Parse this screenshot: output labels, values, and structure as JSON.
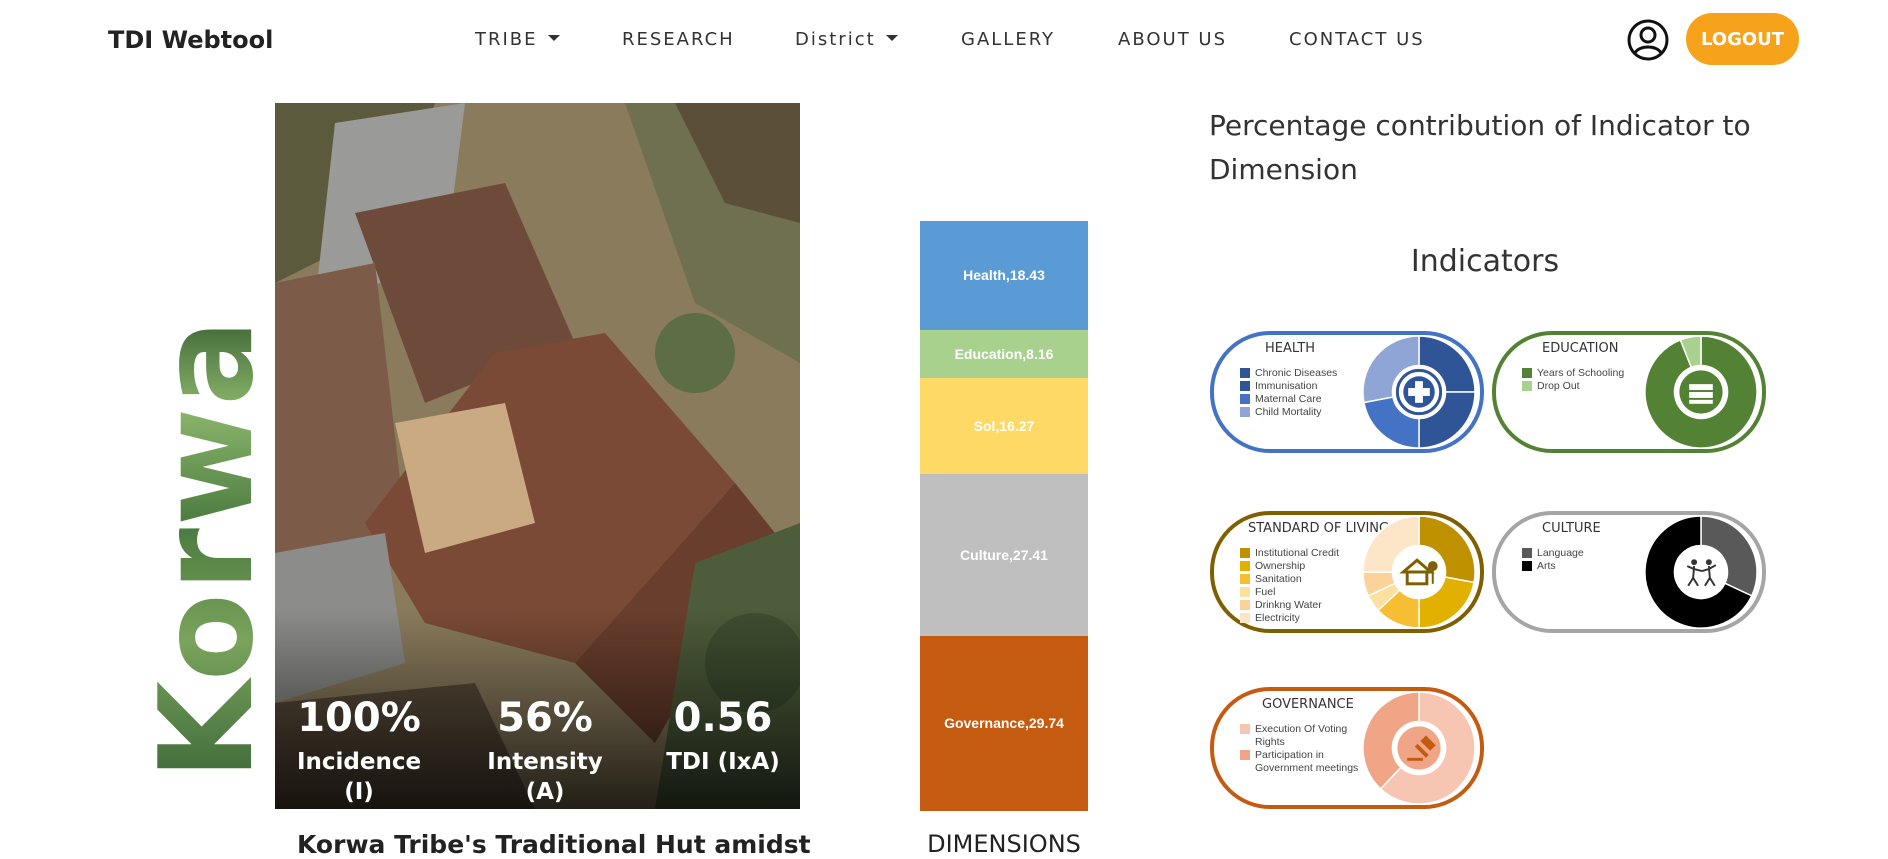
{
  "nav": {
    "brand": "TDI Webtool",
    "items": [
      {
        "label": "TRIBE",
        "dropdown": true
      },
      {
        "label": "RESEARCH",
        "dropdown": false
      },
      {
        "label": "District",
        "dropdown": true
      },
      {
        "label": "GALLERY",
        "dropdown": false
      },
      {
        "label": "ABOUT US",
        "dropdown": false
      },
      {
        "label": "CONTACT US",
        "dropdown": false
      }
    ],
    "user_icon": "user-circle-icon",
    "logout_label": "LOGOUT",
    "logout_color": "#f7a21b"
  },
  "hero": {
    "tribe_name": "Korwa",
    "photo_caption": "Korwa Tribe's Traditional Hut amidst",
    "stats": [
      {
        "value": "100%",
        "label": "Incidence (I)"
      },
      {
        "value": "56%",
        "label": "Intensity (A)"
      },
      {
        "value": "0.56",
        "label": "TDI (IxA)"
      }
    ]
  },
  "chart_data": {
    "type": "bar",
    "stacked": true,
    "xlabel": "DIMENSIONS",
    "segments": [
      {
        "name": "Health",
        "value": 18.43,
        "label": "Health,18.43",
        "color": "#5b9bd5"
      },
      {
        "name": "Education",
        "value": 8.16,
        "label": "Education,8.16",
        "color": "#a9d18e"
      },
      {
        "name": "Sol",
        "value": 16.27,
        "label": "Sol,16.27",
        "color": "#ffd966"
      },
      {
        "name": "Culture",
        "value": 27.41,
        "label": "Culture,27.41",
        "color": "#bfbfbf"
      },
      {
        "name": "Governance",
        "value": 29.74,
        "label": "Governance,29.74",
        "color": "#c55a11"
      }
    ]
  },
  "panel": {
    "title": "Percentage contribution of Indicator to Dimension",
    "indicators_heading": "Indicators"
  },
  "indicators": [
    {
      "title": "HEALTH",
      "border": "#4472c4",
      "icon": "medical-cross-icon",
      "items": [
        {
          "label": "Chronic Diseases",
          "color": "#2f5597",
          "value": 25
        },
        {
          "label": "Immunisation",
          "color": "#2f5597",
          "value": 25
        },
        {
          "label": "Maternal Care",
          "color": "#4472c4",
          "value": 22
        },
        {
          "label": "Child Mortality",
          "color": "#8fa5d6",
          "value": 28
        }
      ]
    },
    {
      "title": "EDUCATION",
      "border": "#548235",
      "icon": "books-icon",
      "items": [
        {
          "label": "Years of Schooling",
          "color": "#548235",
          "value": 94
        },
        {
          "label": "Drop Out",
          "color": "#a9d18e",
          "value": 6
        }
      ]
    },
    {
      "title": "STANDARD OF LIVING",
      "border": "#7f6000",
      "icon": "house-icon",
      "items": [
        {
          "label": "Institutional Credit",
          "color": "#bf9000",
          "value": 28
        },
        {
          "label": "Ownership",
          "color": "#e2b000",
          "value": 22
        },
        {
          "label": "Sanitation",
          "color": "#f5be33",
          "value": 13
        },
        {
          "label": "Fuel",
          "color": "#fbe0a0",
          "value": 5
        },
        {
          "label": "Drinkng Water",
          "color": "#fbd29a",
          "value": 7
        },
        {
          "label": "Electricity",
          "color": "#fde5c7",
          "value": 25
        }
      ]
    },
    {
      "title": "CULTURE",
      "border": "#a5a5a5",
      "icon": "dancers-icon",
      "items": [
        {
          "label": "Language",
          "color": "#595959",
          "value": 32
        },
        {
          "label": "Arts",
          "color": "#000000",
          "value": 68
        }
      ]
    },
    {
      "title": "GOVERNANCE",
      "border": "#c55a11",
      "icon": "gavel-icon",
      "items": [
        {
          "label": "Execution Of Voting Rights",
          "color": "#f6c6b3",
          "value": 62
        },
        {
          "label": "Participation in Government meetings",
          "color": "#f0a587",
          "value": 38
        }
      ]
    }
  ]
}
